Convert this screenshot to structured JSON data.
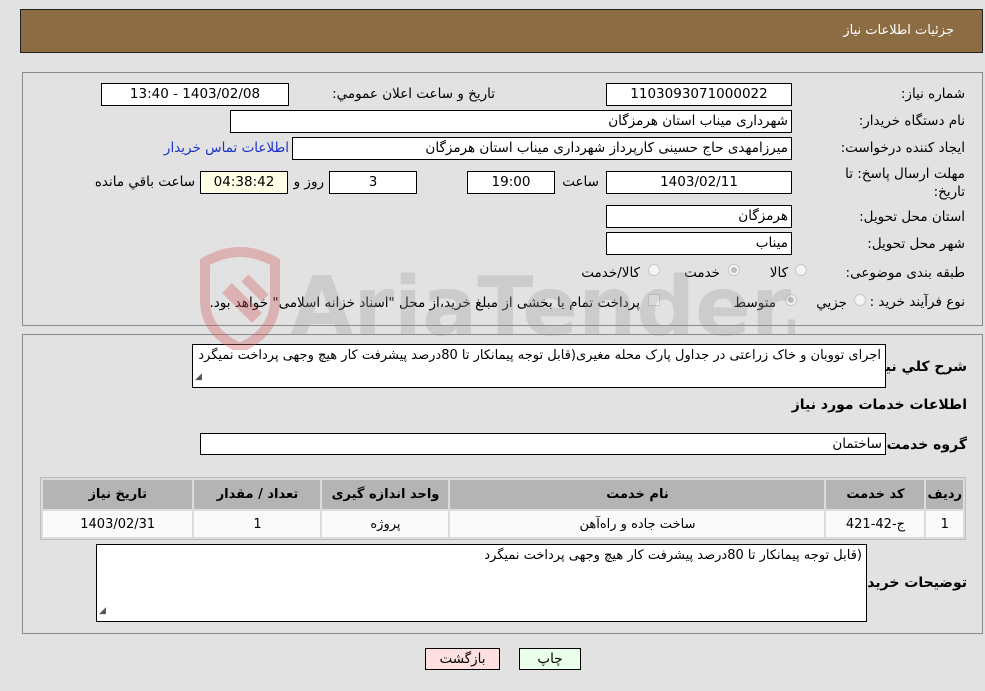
{
  "header": {
    "title": "جزئیات اطلاعات نیاز"
  },
  "info": {
    "need_number_label": "شماره نیاز:",
    "need_number": "1103093071000022",
    "announce_label": "تاریخ و ساعت اعلان عمومي:",
    "announce_value": "1403/02/08 - 13:40",
    "buyer_org_label": "نام دستگاه خریدار:",
    "buyer_org": "شهرداری میناب استان هرمزگان",
    "creator_label": "ایجاد کننده درخواست:",
    "creator": "میرزامهدی حاج حسینی کارپرداز شهرداری میناب استان هرمزگان",
    "contact_link": "اطلاعات تماس خریدار",
    "deadline_label_line1": "مهلت ارسال پاسخ: تا",
    "deadline_label_line2": "تاریخ:",
    "deadline_date": "1403/02/11",
    "time_label": "ساعت",
    "deadline_time": "19:00",
    "days_value": "3",
    "days_label": "روز و",
    "remaining_value": "04:38:42",
    "remaining_label": "ساعت باقي مانده",
    "province_label": "استان محل تحویل:",
    "province": "هرمزگان",
    "city_label": "شهر محل تحویل:",
    "city": "میناب",
    "category_label": "طبقه بندی موضوعی:",
    "category_options": [
      {
        "label": "کالا",
        "selected": false
      },
      {
        "label": "خدمت",
        "selected": true
      },
      {
        "label": "کالا/خدمت",
        "selected": false
      }
    ],
    "process_label": "نوع فرآیند خرید :",
    "process_options": [
      {
        "label": "جزيي",
        "selected": false
      },
      {
        "label": "متوسط",
        "selected": true
      }
    ],
    "treasury_checkbox_label": "پرداخت تمام یا بخشی از مبلغ خرید،از محل \"اسناد خزانه اسلامی\" خواهد بود.",
    "treasury_checked": false
  },
  "details": {
    "description_label": "شرح کلي نیاز:",
    "description": "اجرای تووبان و خاک زراعتی در جداول پارک محله مغیری(قابل توجه پیمانکار تا 80درصد پیشرفت کار هیچ وجهی پرداخت نمیگرد",
    "services_heading": "اطلاعات خدمات مورد نیاز",
    "service_group_label": "گروه خدمت:",
    "service_group": "ساختمان",
    "table": {
      "headers": [
        "ردیف",
        "کد خدمت",
        "نام خدمت",
        "واحد اندازه گیری",
        "تعداد / مقدار",
        "تاریخ نیاز"
      ],
      "rows": [
        [
          "1",
          "ج-42-421",
          "ساخت جاده و راه‌آهن",
          "پروژه",
          "1",
          "1403/02/31"
        ]
      ]
    },
    "buyer_notes_label": "توضیحات خریدار:",
    "buyer_notes": "(قابل توجه پیمانکار تا 80درصد پیشرفت کار هیچ وجهی پرداخت نمیگرد"
  },
  "buttons": {
    "print": "چاپ",
    "back": "بازگشت"
  },
  "watermark": {
    "text": "AriaTender.neT"
  },
  "colors": {
    "header_bg": "#8c6c42",
    "print_bg": "#e9ffe9",
    "back_bg": "#ffe0e0",
    "link": "#1a33cc"
  }
}
